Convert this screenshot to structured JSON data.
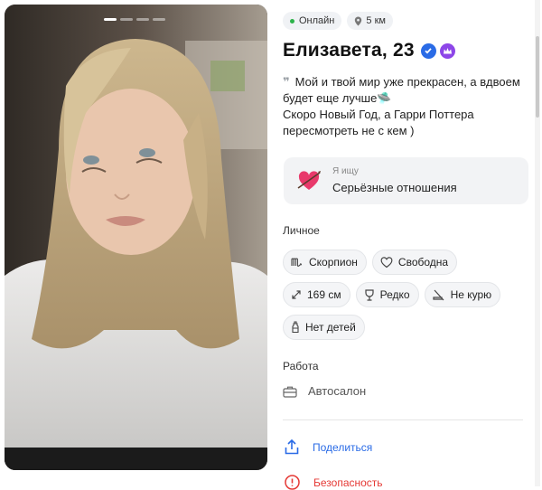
{
  "status": {
    "online_label": "Онлайн",
    "distance_label": "5 км"
  },
  "profile": {
    "name": "Елизавета, 23",
    "bio_line1": "Мой и твой мир уже прекрасен, а вдвоем будет еще лучше🛸",
    "bio_line2": "Скоро Новый Год, а Гарри Поттера пересмотреть не с кем )"
  },
  "looking_for": {
    "label": "Я ищу",
    "value": "Серьёзные отношения"
  },
  "personal": {
    "title": "Личное",
    "tags": [
      {
        "icon": "scorpio-icon",
        "label": "Скорпион"
      },
      {
        "icon": "heart-outline-icon",
        "label": "Свободна"
      },
      {
        "icon": "height-arrows-icon",
        "label": "169 см"
      },
      {
        "icon": "wine-glass-icon",
        "label": "Редко"
      },
      {
        "icon": "no-smoking-icon",
        "label": "Не курю"
      },
      {
        "icon": "baby-bottle-icon",
        "label": "Нет детей"
      }
    ]
  },
  "work": {
    "title": "Работа",
    "value": "Автосалон"
  },
  "actions": {
    "share_label": "Поделиться",
    "security_label": "Безопасность"
  },
  "colors": {
    "accent": "#2a6be6",
    "online": "#2db34a",
    "premium": "#8d46e8",
    "danger": "#e53935"
  },
  "photo": {
    "pages_total": 4,
    "page_active": 1
  }
}
